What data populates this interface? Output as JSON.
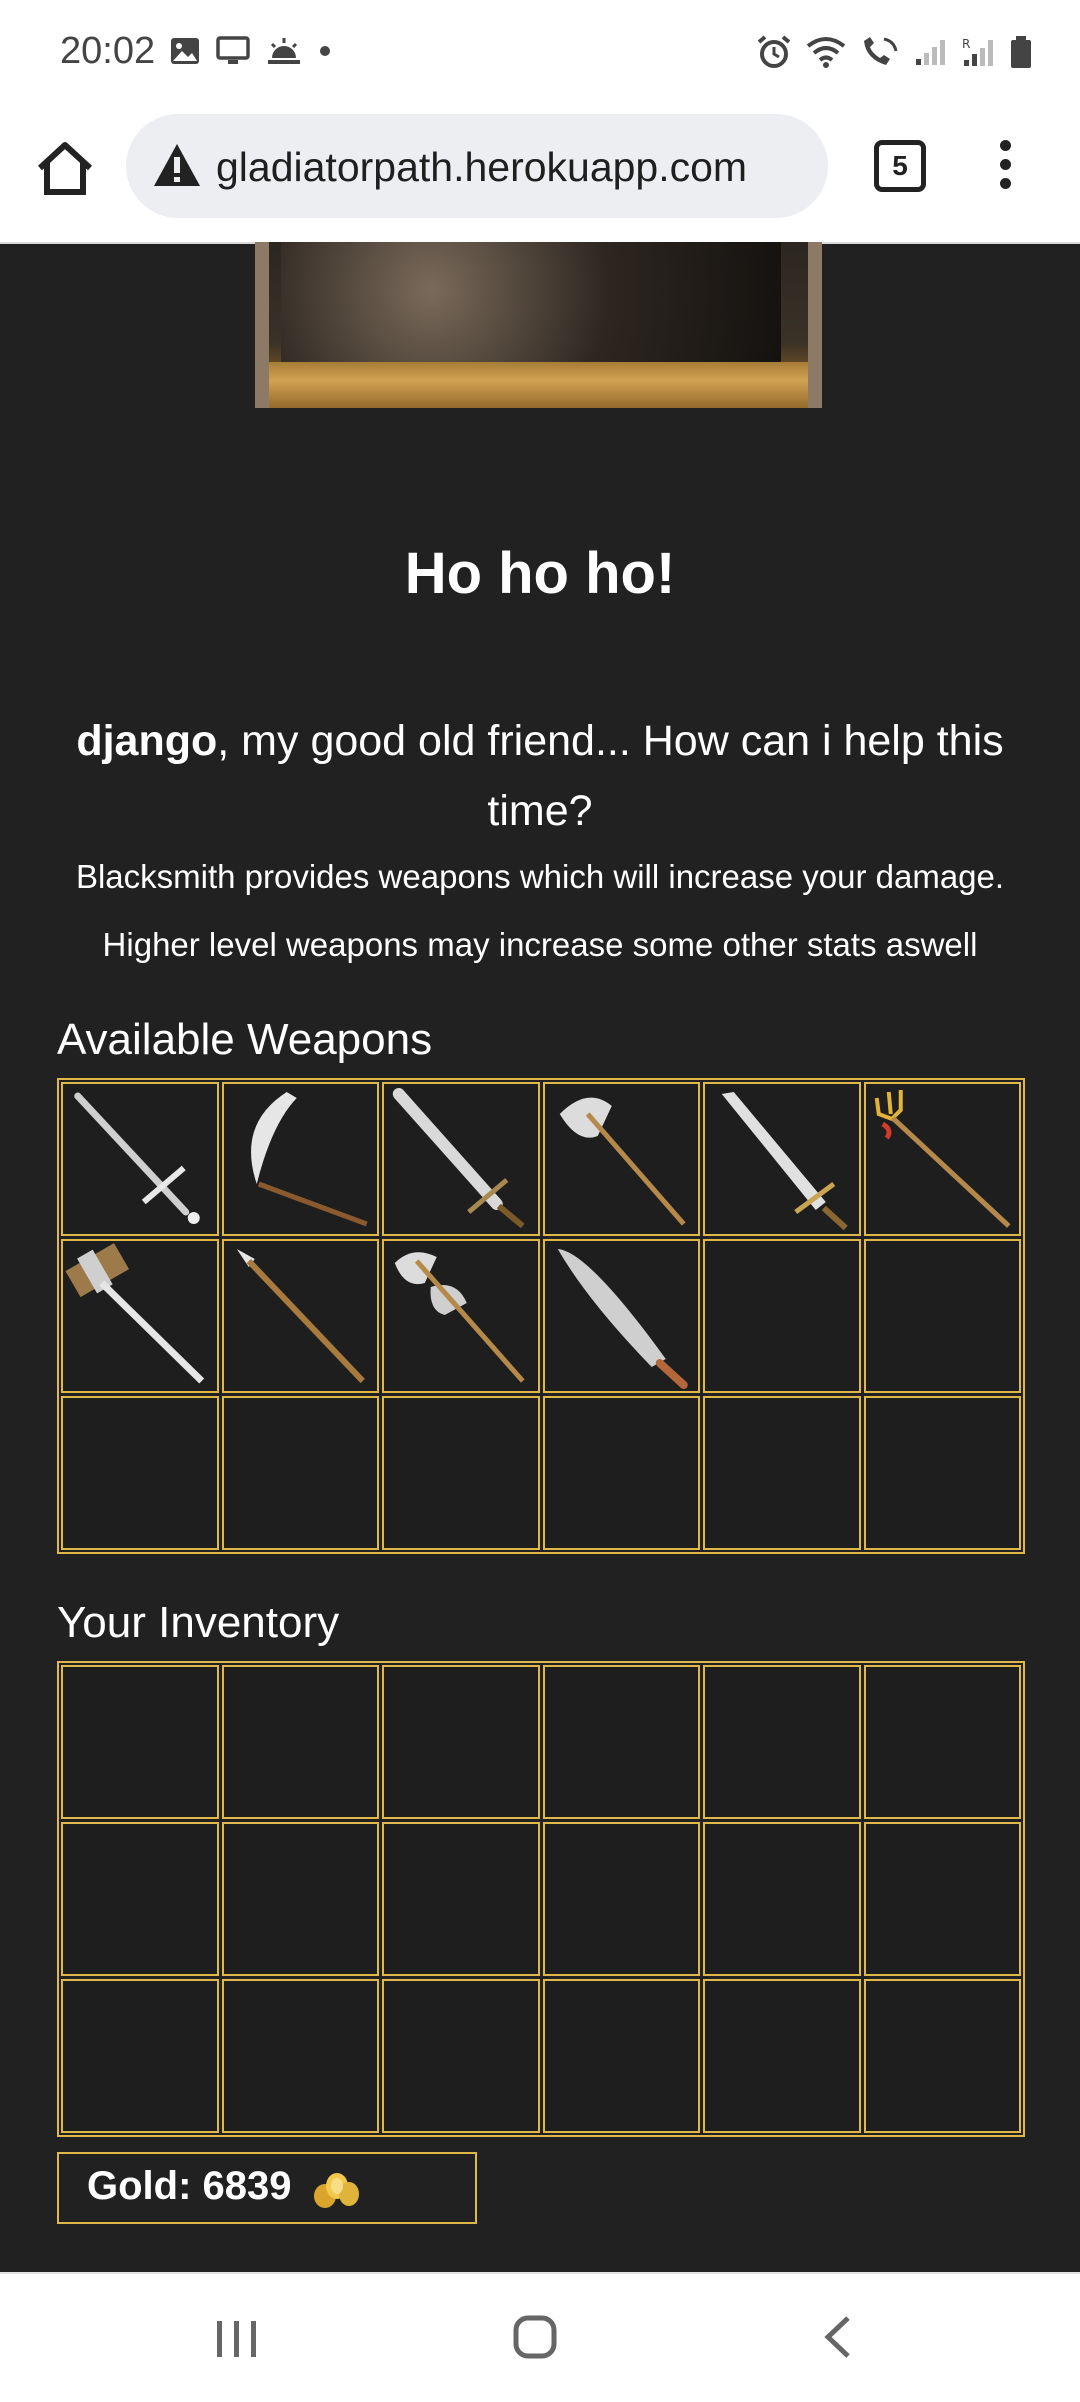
{
  "status_bar": {
    "time": "20:02",
    "left_icons": [
      "image-icon",
      "monitor-icon",
      "weather-icon",
      "dot-icon"
    ],
    "right_icons": [
      "alarm-icon",
      "wifi-icon",
      "wifi-call-icon",
      "signal-icon",
      "signal-roaming-icon",
      "battery-icon"
    ]
  },
  "browser": {
    "url": "gladiatorpath.herokuapp.com",
    "security_icon": "warning-icon",
    "tab_count": "5"
  },
  "page": {
    "title": "Ho ho ho!",
    "greeting_name": "django",
    "greeting_rest": ", my good old friend... How can i help this time?",
    "description_1": "Blacksmith provides weapons which will increase your damage.",
    "description_2": "Higher level weapons may increase some other stats aswell",
    "available_title": "Available Weapons",
    "inventory_title": "Your Inventory",
    "gold_label": "Gold: 6839"
  },
  "available_weapons": [
    "long-sword-icon",
    "scythe-icon",
    "broad-sword-icon",
    "battle-axe-icon",
    "great-sword-icon",
    "trident-icon",
    "war-hammer-icon",
    "spear-icon",
    "double-axe-icon",
    "machete-icon",
    "",
    "",
    "",
    "",
    "",
    "",
    "",
    ""
  ],
  "inventory": [
    "",
    "",
    "",
    "",
    "",
    "",
    "",
    "",
    "",
    "",
    "",
    "",
    "",
    "",
    "",
    "",
    "",
    ""
  ],
  "colors": {
    "background": "#222122",
    "grid_border": "#e0b84a",
    "text": "#ffffff"
  }
}
